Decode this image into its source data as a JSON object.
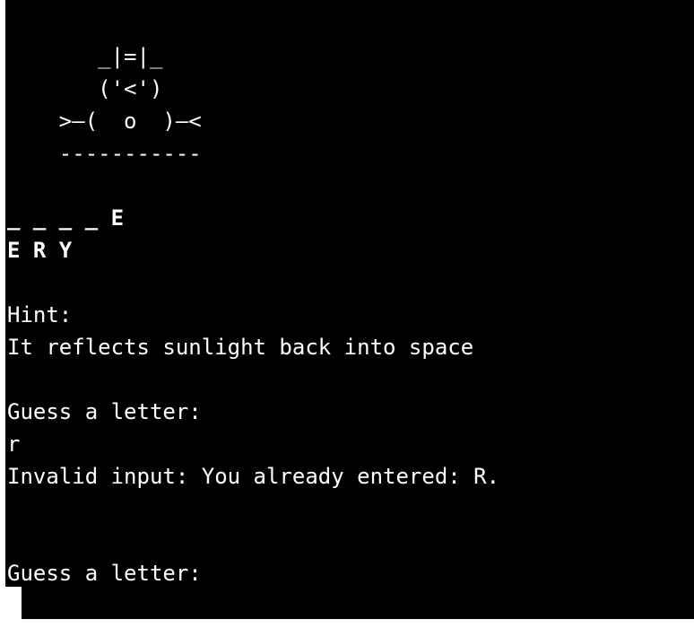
{
  "terminal": {
    "art": [
      "       _|=|_",
      "       ('<')",
      "    >—(  o  )—<",
      "    -----------"
    ],
    "word_blanks": "_ _ _ _ E",
    "guessed_letters": "E R Y",
    "hint_label": "Hint:",
    "hint_text": "It reflects sunlight back into space",
    "prompt_1": "Guess a letter:",
    "user_input": "r",
    "error_message": "Invalid input: You already entered: R.",
    "prompt_2": "Guess a letter:"
  }
}
